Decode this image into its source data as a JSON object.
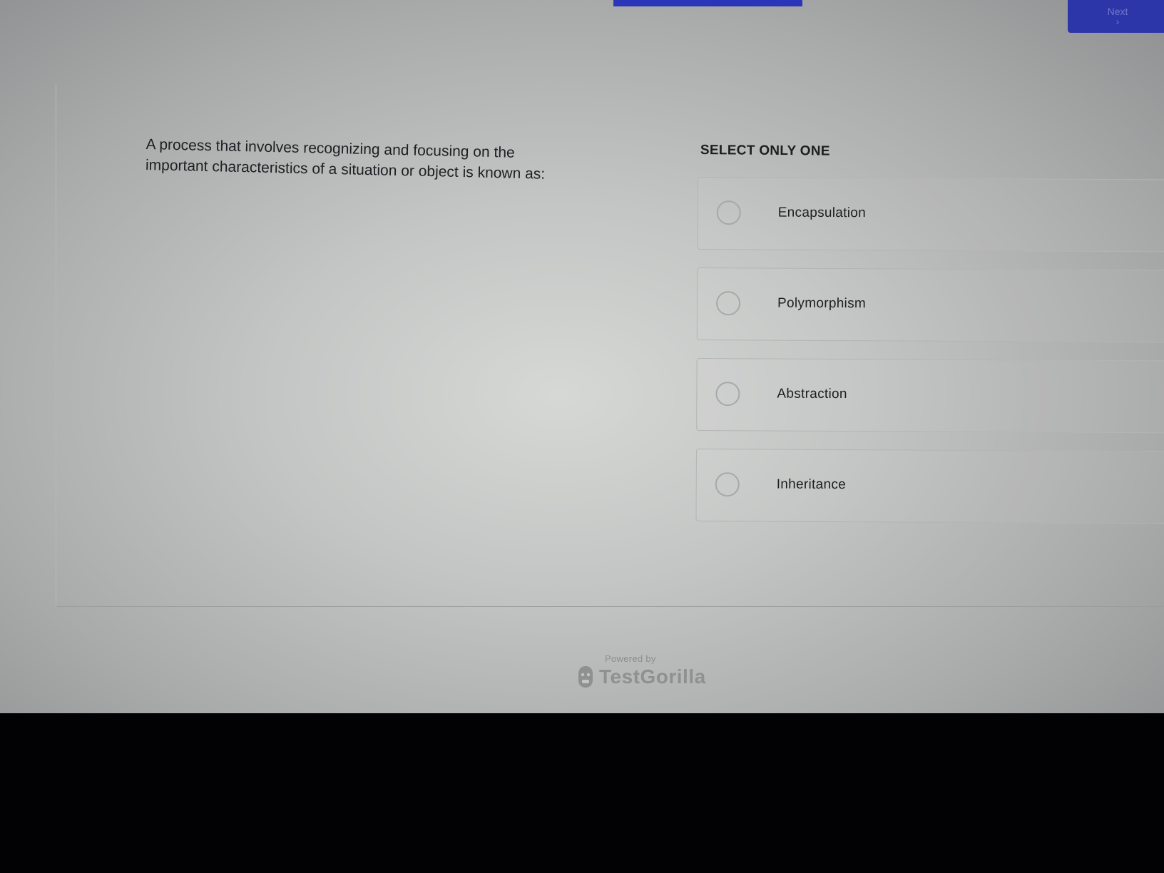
{
  "progress": {
    "fraction": 0.7
  },
  "header": {
    "button_label": "Next"
  },
  "question": {
    "line1": "A process that involves recognizing and focusing on the",
    "line2": "important characteristics of a situation or object is known as:"
  },
  "answers": {
    "instruction": "SELECT ONLY ONE",
    "options": [
      {
        "label": "Encapsulation"
      },
      {
        "label": "Polymorphism"
      },
      {
        "label": "Abstraction"
      },
      {
        "label": "Inheritance"
      }
    ]
  },
  "footer": {
    "powered_by": "Powered by",
    "brand": "TestGorilla",
    "brand_icon": "gorilla-icon"
  },
  "colors": {
    "accent": "#2a35b8",
    "text": "#1d1e20",
    "muted": "#8c8e8e"
  }
}
